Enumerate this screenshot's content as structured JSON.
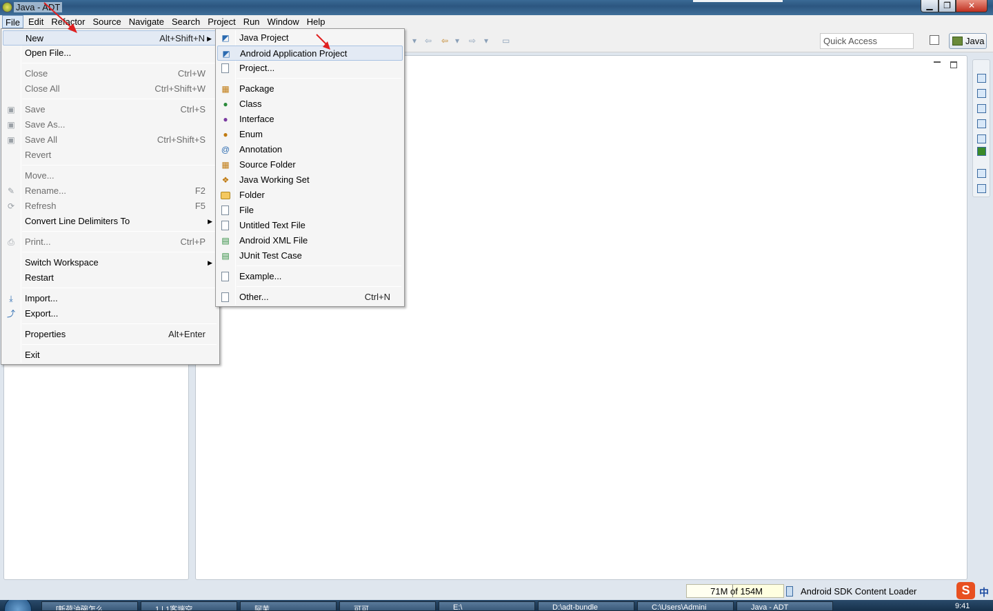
{
  "window": {
    "title": "Java - ADT"
  },
  "menubar": [
    "File",
    "Edit",
    "Refactor",
    "Source",
    "Navigate",
    "Search",
    "Project",
    "Run",
    "Window",
    "Help"
  ],
  "toolbar": {
    "quick_access_placeholder": "Quick Access",
    "perspective": "Java"
  },
  "file_menu": {
    "new": {
      "label": "New",
      "accel": "Alt+Shift+N"
    },
    "open_file": "Open File...",
    "close": {
      "label": "Close",
      "accel": "Ctrl+W"
    },
    "close_all": {
      "label": "Close All",
      "accel": "Ctrl+Shift+W"
    },
    "save": {
      "label": "Save",
      "accel": "Ctrl+S"
    },
    "save_as": "Save As...",
    "save_all": {
      "label": "Save All",
      "accel": "Ctrl+Shift+S"
    },
    "revert": "Revert",
    "move": "Move...",
    "rename": {
      "label": "Rename...",
      "accel": "F2"
    },
    "refresh": {
      "label": "Refresh",
      "accel": "F5"
    },
    "convert": "Convert Line Delimiters To",
    "print": {
      "label": "Print...",
      "accel": "Ctrl+P"
    },
    "switch_workspace": "Switch Workspace",
    "restart": "Restart",
    "import": "Import...",
    "export": "Export...",
    "properties": {
      "label": "Properties",
      "accel": "Alt+Enter"
    },
    "exit": "Exit"
  },
  "new_menu": {
    "java_project": "Java Project",
    "android_app_project": "Android Application Project",
    "project": "Project...",
    "package": "Package",
    "class": "Class",
    "interface": "Interface",
    "enum": "Enum",
    "annotation": "Annotation",
    "source_folder": "Source Folder",
    "java_working_set": "Java Working Set",
    "folder": "Folder",
    "file": "File",
    "untitled_text_file": "Untitled Text File",
    "android_xml_file": "Android XML File",
    "junit_test_case": "JUnit Test Case",
    "example": "Example...",
    "other": {
      "label": "Other...",
      "accel": "Ctrl+N"
    }
  },
  "status": {
    "heap": "71M of 154M",
    "heap_used_fraction": 0.46,
    "message": "Android SDK Content Loader",
    "ime": "中",
    "ime_logo": "S"
  },
  "taskbar": {
    "items": [
      "[新荷油碗怎么",
      "1 | 1客端空",
      "阿茉",
      "可可",
      "E:\\",
      "D:\\adt-bundle",
      "C:\\Users\\Admini",
      "Java - ADT"
    ],
    "clock": "9:41"
  },
  "colors": {
    "menu_highlight": "#e3eaf4",
    "annotation_arrow": "#e02020"
  }
}
